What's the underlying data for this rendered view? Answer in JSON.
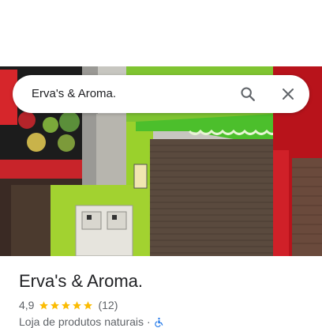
{
  "search": {
    "query": "Erva's & Aroma."
  },
  "place": {
    "name": "Erva's & Aroma.",
    "rating_value": "4,9",
    "rating_stars": 5,
    "review_count": "(12)",
    "category": "Loja de produtos naturais",
    "separator": "·"
  },
  "icons": {
    "search": "search-icon",
    "close": "close-icon",
    "star": "star-icon",
    "accessibility": "wheelchair-icon"
  },
  "colors": {
    "star": "#fbbc04",
    "accessibility": "#1a73e8",
    "awning_green": "#4cbf2c",
    "wall_lime": "#9ad12c",
    "facade_red": "#b8131b"
  }
}
